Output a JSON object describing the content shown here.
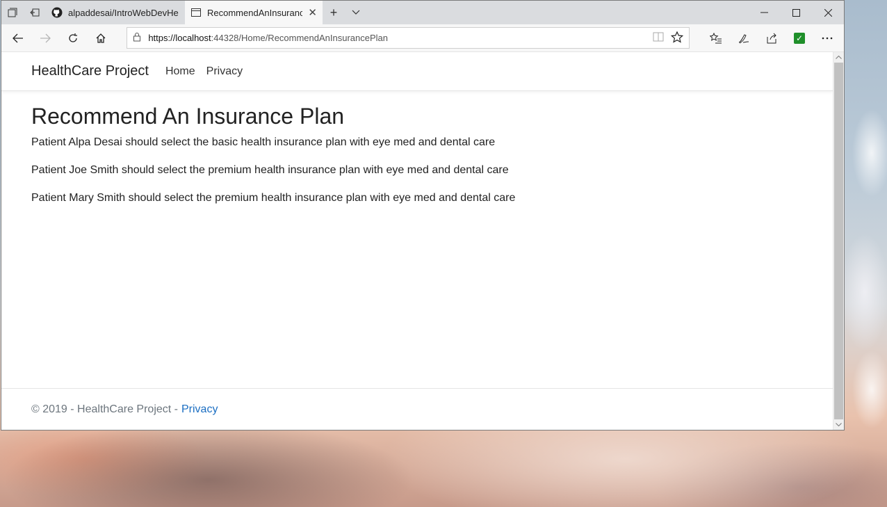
{
  "browser": {
    "tabs": [
      {
        "label": "alpaddesai/IntroWebDevHe",
        "icon": "github-icon",
        "active": false
      },
      {
        "label": "RecommendAnInsuranc",
        "icon": "page-icon",
        "active": true
      }
    ],
    "new_tab": "+",
    "url_host": "https://localhost",
    "url_rest": ":44328/Home/RecommendAnInsurancePlan"
  },
  "site": {
    "brand": "HealthCare Project",
    "nav": [
      {
        "label": "Home"
      },
      {
        "label": "Privacy"
      }
    ],
    "heading": "Recommend An Insurance Plan",
    "lines": [
      "Patient Alpa Desai should select the basic health insurance plan with eye med and dental care",
      "Patient Joe Smith should select the premium health insurance plan with eye med and dental care",
      "Patient Mary Smith should select the premium health insurance plan with eye med and dental care"
    ],
    "footer_text": "© 2019 - HealthCare Project -",
    "footer_link": "Privacy"
  },
  "colors": {
    "link": "#1b6ec2",
    "tabstrip": "#dadcdf"
  }
}
